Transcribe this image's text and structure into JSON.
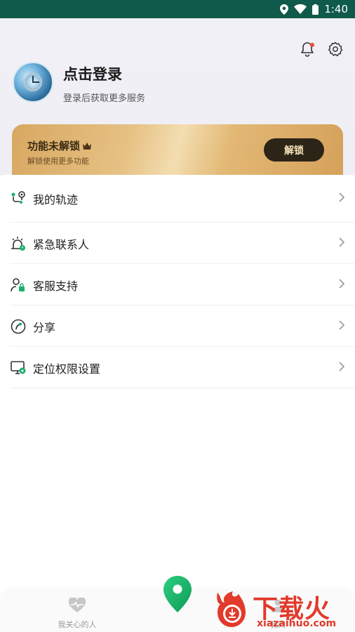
{
  "status_bar": {
    "time": "1:40",
    "icons": [
      "location-icon",
      "wifi-icon",
      "battery-icon"
    ]
  },
  "header": {
    "notification_icon": "bell-icon",
    "settings_icon": "gear-icon",
    "login_title": "点击登录",
    "login_subtitle": "登录后获取更多服务"
  },
  "unlock_card": {
    "title": "功能未解锁",
    "title_icon": "crown-icon",
    "subtitle": "解锁使用更多功能",
    "button_label": "解锁"
  },
  "menu": {
    "items": [
      {
        "label": "我的轨迹",
        "icon": "track-route-icon"
      },
      {
        "label": "紧急联系人",
        "icon": "emergency-contact-icon"
      },
      {
        "label": "客服支持",
        "icon": "customer-service-icon"
      },
      {
        "label": "分享",
        "icon": "share-icon"
      },
      {
        "label": "定位权限设置",
        "icon": "location-permission-icon"
      }
    ]
  },
  "tab_bar": {
    "left_tab": {
      "label": "我关心的人",
      "icon": "heart-pulse-icon"
    },
    "center_icon": "location-pin-icon",
    "right_tab": {
      "label": "我的",
      "icon": "person-icon"
    }
  },
  "watermark": {
    "brand": "下载火",
    "url": "xiazaihuo.com"
  },
  "colors": {
    "status_bar": "#0f5a4a",
    "accent_green": "#18b06a",
    "gold_start": "#d8a861",
    "gold_button": "#2c2417",
    "watermark_red": "#e23a2b"
  }
}
